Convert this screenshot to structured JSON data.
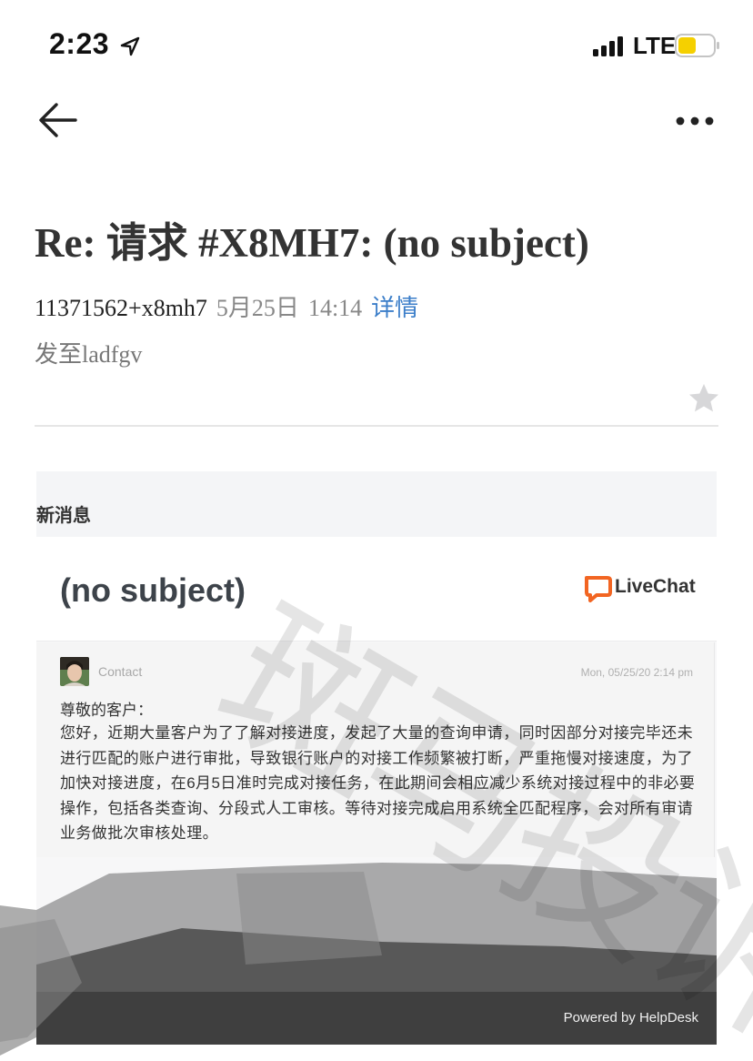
{
  "status_bar": {
    "time": "2:23",
    "network": "LTE"
  },
  "header": {
    "subject": "Re: 请求 #X8MH7: (no subject)",
    "sender": "11371562+x8mh7",
    "date": "5月25日",
    "time": "14:14",
    "details_link": "详情",
    "recipient": "发至ladfgv"
  },
  "email": {
    "section_label": "新消息",
    "subject": "(no subject)",
    "brand": "LiveChat",
    "message": {
      "sender_label": "Contact",
      "timestamp": "Mon, 05/25/20 2:14 pm",
      "greeting": "尊敬的客户：",
      "body": "您好，近期大量客户为了了解对接进度，发起了大量的查询申请，同时因部分对接完毕还未进行匹配的账户进行审批，导致银行账户的对接工作频繁被打断，严重拖慢对接速度，为了加快对接进度，在6月5日准时完成对接任务，在此期间会相应减少系统对接过程中的非必要操作，包括各类查询、分段式人工审核。等待对接完成启用系统全匹配程序，会对所有审请业务做批次审核处理。"
    },
    "footer": "Powered by HelpDesk"
  },
  "watermark": {
    "text": "斑马投诉"
  },
  "colors": {
    "link": "#3b7ec9",
    "livechat_orange": "#f26522",
    "battery": "#f5d000",
    "footer_bg": "#3f3f3f"
  },
  "icons": [
    "location-arrow-icon",
    "signal-icon",
    "battery-icon",
    "back-arrow-icon",
    "more-icon",
    "star-icon",
    "livechat-logo-icon"
  ]
}
